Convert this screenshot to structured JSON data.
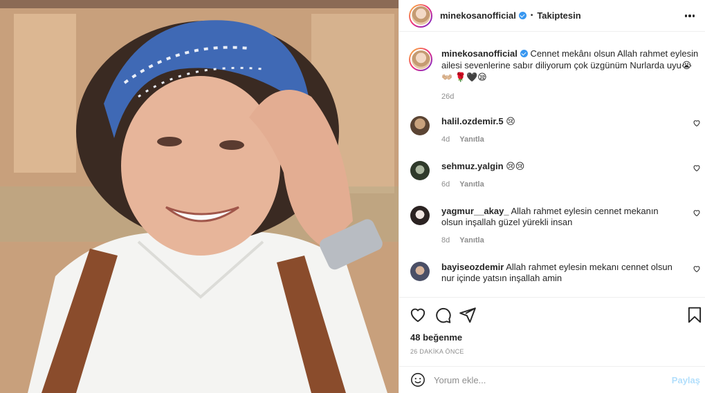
{
  "header": {
    "username": "minekosanofficial",
    "separator": "•",
    "follow_label": "Takiptesin",
    "more_icon": "more-horizontal-icon"
  },
  "caption": {
    "username": "minekosanofficial",
    "text": "Cennet mekânı olsun Allah rahmet eylesin ailesi sevenlerine sabır diliyorum çok üzgünüm Nurlarda uyu😭👐🏼 🌹🖤😪",
    "age": "26d"
  },
  "comments": [
    {
      "username": "halil.ozdemir.5",
      "text": "😢",
      "age": "4d",
      "reply": "Yanıtla"
    },
    {
      "username": "sehmuz.yalgin",
      "text": "😢😢",
      "age": "6d",
      "reply": "Yanıtla"
    },
    {
      "username": "yagmur__akay_",
      "text": "Allah rahmet eylesin cennet mekanın olsun inşallah güzel yürekli insan",
      "age": "8d",
      "reply": "Yanıtla"
    },
    {
      "username": "bayiseozdemir",
      "text": "Allah rahmet eylesin mekanı cennet olsun nur içinde yatsın inşallah amin",
      "age": "",
      "reply": ""
    }
  ],
  "actions": {
    "likes": "48 beğenme",
    "timestamp": "26 DAKİKA ÖNCE"
  },
  "add_comment": {
    "placeholder": "Yorum ekle...",
    "post_label": "Paylaş"
  },
  "colors": {
    "verified": "#3897f0",
    "muted": "#8e8e8e",
    "post_disabled": "#b2dffc"
  }
}
